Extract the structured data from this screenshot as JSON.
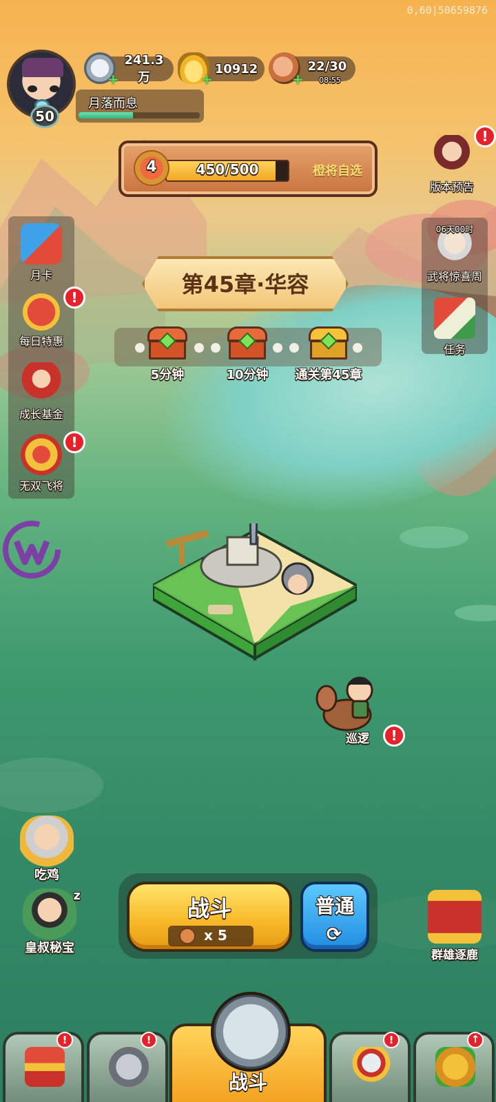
{
  "watermark": "0,60|50659876",
  "player": {
    "name": "月落而息",
    "level": "50",
    "xp_fraction": 0.45
  },
  "resources": {
    "silver": "241.3万",
    "gold": "10912",
    "stamina": "22/30",
    "stamina_timer": "08:55"
  },
  "progress_banner": {
    "rank": "4",
    "progress": "450/500",
    "progress_fraction": 0.9,
    "action": "橙将自选"
  },
  "left_menu": [
    {
      "label": "月卡",
      "icon": "month-card-icon",
      "alert": false
    },
    {
      "label": "每日特惠",
      "icon": "daily-deal-icon",
      "alert": true
    },
    {
      "label": "成长基金",
      "icon": "growth-fund-icon",
      "alert": false
    },
    {
      "label": "无双飞将",
      "icon": "peerless-general-icon",
      "alert": true
    }
  ],
  "right_menu": {
    "version_preview": "版本预告",
    "surprise_week_timer": "06天00时",
    "surprise_week": "武将惊喜周",
    "tasks": "任务"
  },
  "chapter": {
    "title": "第45章·华容",
    "chests": [
      {
        "label": "5分钟"
      },
      {
        "label": "10分钟"
      },
      {
        "label": "通关第45章"
      }
    ]
  },
  "patrol": {
    "label": "巡逻"
  },
  "left_bottom": [
    {
      "label": "吃鸡"
    },
    {
      "label": "皇叔秘宝"
    }
  ],
  "sleep_mark": "z",
  "right_bottom": {
    "label": "群雄逐鹿"
  },
  "battle": {
    "label": "战斗",
    "cost": "x 5",
    "mode": "普通",
    "refresh": "⟳"
  },
  "bottom_nav": {
    "center_label": "战斗"
  },
  "alert_mark": "!",
  "upgrade_mark": "↑",
  "colors": {
    "accent_yellow": "#f7b726",
    "alert_red": "#e5222b",
    "mode_blue": "#228ce0"
  }
}
